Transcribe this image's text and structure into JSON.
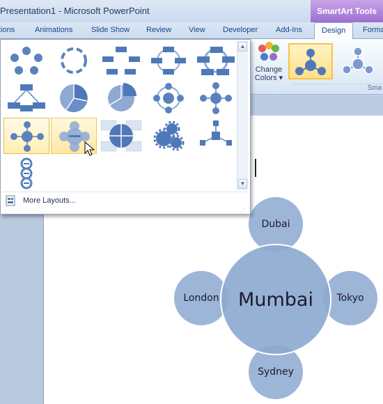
{
  "window": {
    "title": "Presentation1 - Microsoft PowerPoint",
    "contextual_tab": "SmartArt Tools"
  },
  "tabs": [
    {
      "label": "tions",
      "active": false
    },
    {
      "label": "Animations",
      "active": false
    },
    {
      "label": "Slide Show",
      "active": false
    },
    {
      "label": "Review",
      "active": false
    },
    {
      "label": "View",
      "active": false
    },
    {
      "label": "Developer",
      "active": false
    },
    {
      "label": "Add-Ins",
      "active": false
    },
    {
      "label": "Design",
      "active": true
    },
    {
      "label": "Forma",
      "active": false
    }
  ],
  "ribbon": {
    "change_colors_line1": "Change",
    "change_colors_line2": "Colors ▾",
    "group_label": "Sma",
    "swatch_colors": [
      "#e35d5d",
      "#f2b134",
      "#6bb34b",
      "#4b7cc7",
      "#9b6bc9"
    ]
  },
  "gallery": {
    "more_layouts": "More Layouts...",
    "scroll_up": "▲",
    "scroll_down": "▼",
    "grip": "⋰",
    "layouts": [
      {
        "name": "basic-cycle",
        "state": "normal"
      },
      {
        "name": "segmented-cycle",
        "state": "normal"
      },
      {
        "name": "block-cycle",
        "state": "normal"
      },
      {
        "name": "nondirectional-cycle",
        "state": "normal"
      },
      {
        "name": "continuous-cycle",
        "state": "normal"
      },
      {
        "name": "hierarchy-cycle",
        "state": "normal"
      },
      {
        "name": "basic-pie",
        "state": "normal"
      },
      {
        "name": "segmented-pie",
        "state": "normal"
      },
      {
        "name": "radial-cycle",
        "state": "normal"
      },
      {
        "name": "basic-radial",
        "state": "normal"
      },
      {
        "name": "diverging-radial",
        "state": "selected"
      },
      {
        "name": "radial-venn",
        "state": "hover"
      },
      {
        "name": "cycle-matrix",
        "state": "normal"
      },
      {
        "name": "gear",
        "state": "normal"
      },
      {
        "name": "radial-cluster",
        "state": "normal"
      },
      {
        "name": "circle-arrow-process",
        "state": "normal"
      }
    ]
  },
  "smartart": {
    "center": "Mumbai",
    "nodes": {
      "top": "Dubai",
      "left": "London",
      "right": "Tokyo",
      "bottom": "Sydney"
    },
    "fill_color": "#8ca8d0"
  }
}
